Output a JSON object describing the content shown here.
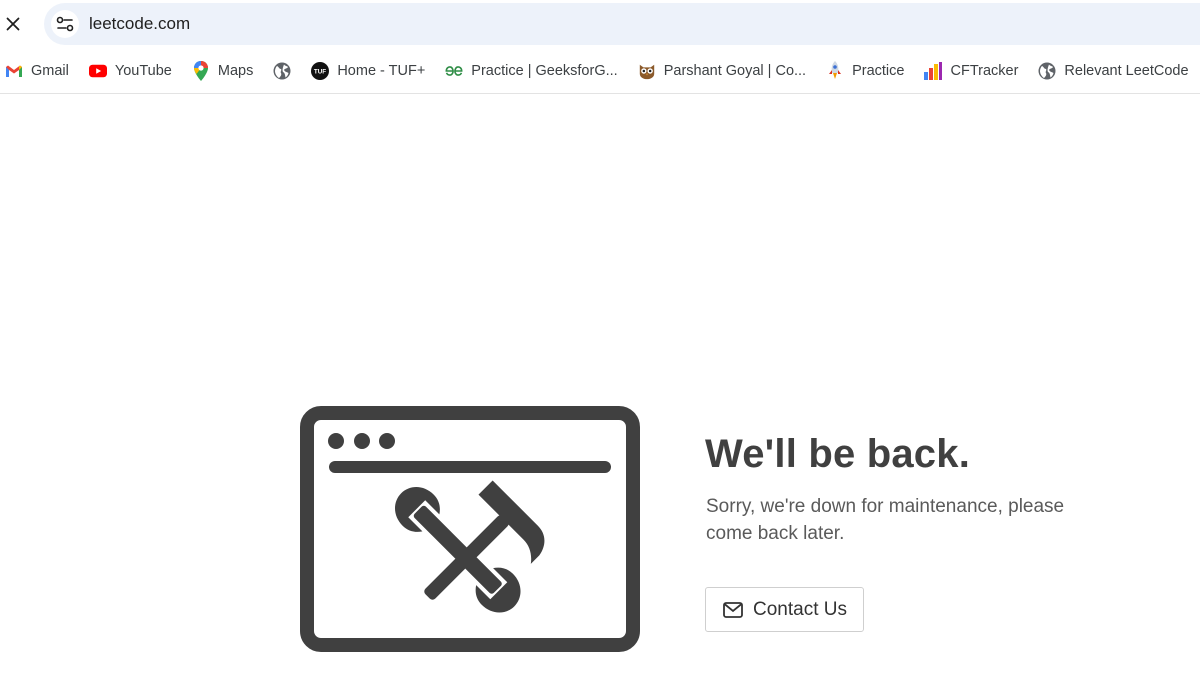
{
  "browser": {
    "close_icon": "close-icon",
    "site_info_icon": "tune-icon",
    "url": "leetcode.com"
  },
  "bookmarks": [
    {
      "label": "Gmail",
      "icon": "gmail-icon"
    },
    {
      "label": "YouTube",
      "icon": "youtube-icon"
    },
    {
      "label": "Maps",
      "icon": "maps-icon"
    },
    {
      "label": "",
      "icon": "globe-icon"
    },
    {
      "label": "Home - TUF+",
      "icon": "tuf-icon"
    },
    {
      "label": "Practice | GeeksforG...",
      "icon": "gfg-icon"
    },
    {
      "label": "Parshant Goyal | Co...",
      "icon": "owl-icon"
    },
    {
      "label": "Practice",
      "icon": "rocket-icon"
    },
    {
      "label": "CFTracker",
      "icon": "bar-chart-icon"
    },
    {
      "label": "Relevant LeetCode",
      "icon": "globe-icon"
    }
  ],
  "maintenance": {
    "heading": "We'll be back.",
    "message": "Sorry, we're down for maintenance, please come back later.",
    "contact_label": "Contact Us",
    "illustration": "browser-window-with-tools-icon",
    "color": "#404040"
  }
}
